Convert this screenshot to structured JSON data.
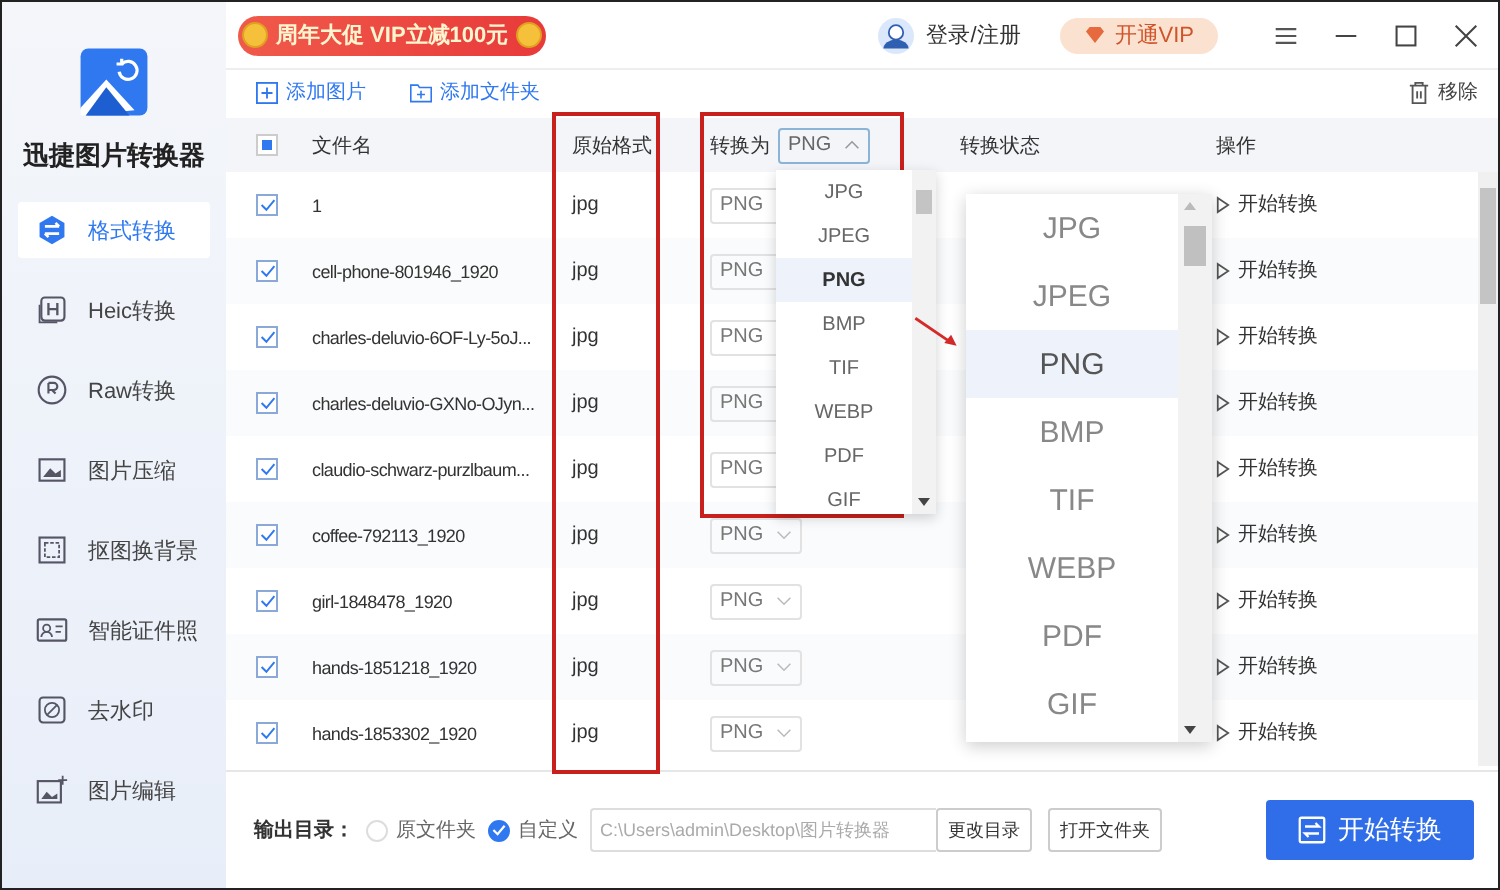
{
  "app": {
    "name": "迅捷图片转换器"
  },
  "promo": {
    "text": "周年大促 VIP立减100元"
  },
  "account": {
    "login": "登录/注册",
    "vip": "开通VIP"
  },
  "sidebar": {
    "items": [
      {
        "label": "格式转换",
        "selected": true
      },
      {
        "label": "Heic转换",
        "selected": false
      },
      {
        "label": "Raw转换",
        "selected": false
      },
      {
        "label": "图片压缩",
        "selected": false
      },
      {
        "label": "抠图换背景",
        "selected": false
      },
      {
        "label": "智能证件照",
        "selected": false
      },
      {
        "label": "去水印",
        "selected": false
      },
      {
        "label": "图片编辑",
        "selected": false
      }
    ]
  },
  "toolbar": {
    "add_image": "添加图片",
    "add_folder": "添加文件夹",
    "remove": "移除"
  },
  "table": {
    "select_all_checked": true,
    "columns": [
      "文件名",
      "原始格式",
      "转换为",
      "转换状态",
      "操作"
    ],
    "header_select": {
      "value": "PNG",
      "expanded": true
    },
    "rows": [
      {
        "checked": true,
        "name": "1",
        "format": "jpg",
        "target": "PNG",
        "action": "开始转换"
      },
      {
        "checked": true,
        "name": "cell-phone-801946_1920",
        "format": "jpg",
        "target": "PNG",
        "action": "开始转换"
      },
      {
        "checked": true,
        "name": "charles-deluvio-6OF-Ly-5oJ...",
        "format": "jpg",
        "target": "PNG",
        "action": "开始转换"
      },
      {
        "checked": true,
        "name": "charles-deluvio-GXNo-OJyn...",
        "format": "jpg",
        "target": "PNG",
        "action": "开始转换"
      },
      {
        "checked": true,
        "name": "claudio-schwarz-purzlbaum...",
        "format": "jpg",
        "target": "PNG",
        "action": "开始转换"
      },
      {
        "checked": true,
        "name": "coffee-792113_1920",
        "format": "jpg",
        "target": "PNG",
        "action": "开始转换"
      },
      {
        "checked": true,
        "name": "girl-1848478_1920",
        "format": "jpg",
        "target": "PNG",
        "action": "开始转换"
      },
      {
        "checked": true,
        "name": "hands-1851218_1920",
        "format": "jpg",
        "target": "PNG",
        "action": "开始转换"
      },
      {
        "checked": true,
        "name": "hands-1853302_1920",
        "format": "jpg",
        "target": "PNG",
        "action": "开始转换"
      }
    ]
  },
  "format_dropdown": {
    "options": [
      {
        "label": "JPG",
        "selected": false
      },
      {
        "label": "JPEG",
        "selected": false
      },
      {
        "label": "PNG",
        "selected": true
      },
      {
        "label": "BMP",
        "selected": false
      },
      {
        "label": "TIF",
        "selected": false
      },
      {
        "label": "WEBP",
        "selected": false
      },
      {
        "label": "PDF",
        "selected": false
      },
      {
        "label": "GIF",
        "selected": false
      }
    ]
  },
  "zoom_callout": {
    "options": [
      {
        "label": "JPG",
        "selected": false
      },
      {
        "label": "JPEG",
        "selected": false
      },
      {
        "label": "PNG",
        "selected": true
      },
      {
        "label": "BMP",
        "selected": false
      },
      {
        "label": "TIF",
        "selected": false
      },
      {
        "label": "WEBP",
        "selected": false
      },
      {
        "label": "PDF",
        "selected": false
      },
      {
        "label": "GIF",
        "selected": false
      }
    ]
  },
  "footer": {
    "output_label": "输出目录：",
    "options": [
      {
        "label": "原文件夹",
        "selected": false
      },
      {
        "label": "自定义",
        "selected": true
      }
    ],
    "path": "C:\\Users\\admin\\Desktop\\图片转换器",
    "change_dir": "更改目录",
    "open_folder": "打开文件夹",
    "start": "开始转换"
  }
}
